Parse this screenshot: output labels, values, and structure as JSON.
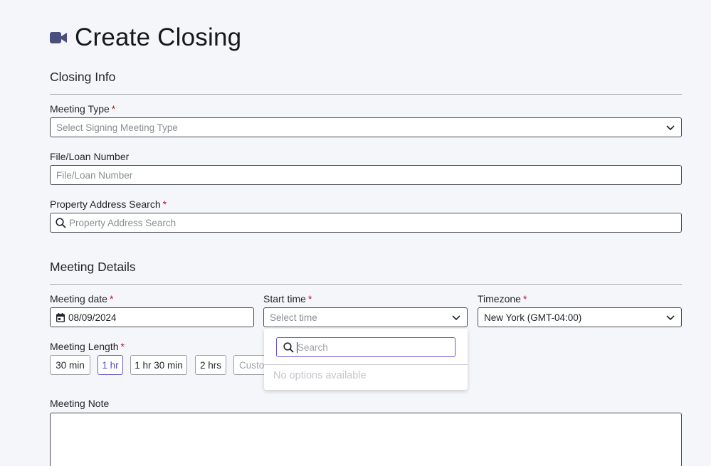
{
  "page": {
    "title": "Create Closing"
  },
  "closing_info": {
    "section_title": "Closing Info",
    "meeting_type": {
      "label": "Meeting Type",
      "placeholder": "Select Signing Meeting Type"
    },
    "file_loan_number": {
      "label": "File/Loan Number",
      "placeholder": "File/Loan Number"
    },
    "property_address": {
      "label": "Property Address Search",
      "placeholder": "Property Address Search"
    }
  },
  "meeting_details": {
    "section_title": "Meeting Details",
    "meeting_date": {
      "label": "Meeting date",
      "value": "08/09/2024"
    },
    "start_time": {
      "label": "Start time",
      "placeholder": "Select time"
    },
    "timezone": {
      "label": "Timezone",
      "value": "New York (GMT-04:00)"
    },
    "meeting_length": {
      "label": "Meeting Length",
      "options": [
        "30 min",
        "1 hr",
        "1 hr 30 min",
        "2 hrs"
      ],
      "selected": "1 hr",
      "custom_placeholder": "Custo"
    },
    "meeting_note": {
      "label": "Meeting Note"
    }
  },
  "start_time_dropdown": {
    "search_placeholder": "Search",
    "empty_text": "No options available"
  },
  "required_marker": "*",
  "colors": {
    "accent": "#5b49c9",
    "required": "#b5172e",
    "icon": "#4b4f7e"
  }
}
